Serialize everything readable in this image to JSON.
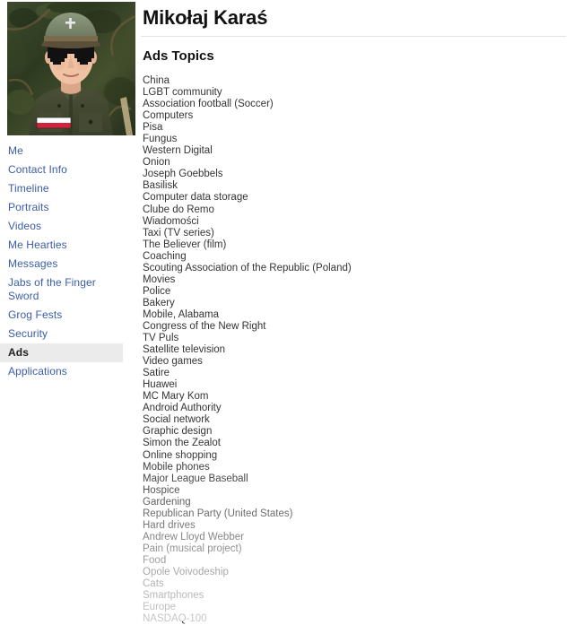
{
  "profile": {
    "name": "Mikołaj Karaś",
    "photo_alt": "profile-portrait-person-in-uniform-with-cap-and-sunglasses"
  },
  "sidebar": {
    "items": [
      {
        "label": "Me",
        "active": false
      },
      {
        "label": "Contact Info",
        "active": false
      },
      {
        "label": "Timeline",
        "active": false
      },
      {
        "label": "Portraits",
        "active": false
      },
      {
        "label": "Videos",
        "active": false
      },
      {
        "label": "Me Hearties",
        "active": false
      },
      {
        "label": "Messages",
        "active": false
      },
      {
        "label": "Jabs of the Finger Sword",
        "active": false
      },
      {
        "label": "Grog Fests",
        "active": false
      },
      {
        "label": "Security",
        "active": false
      },
      {
        "label": "Ads",
        "active": true
      },
      {
        "label": "Applications",
        "active": false
      }
    ]
  },
  "main": {
    "section_title": "Ads Topics",
    "topics": [
      "China",
      "LGBT community",
      "Association football (Soccer)",
      "Computers",
      "Pisa",
      "Fungus",
      "Western Digital",
      "Onion",
      "Joseph Goebbels",
      "Basilisk",
      "Computer data storage",
      "Clube do Remo",
      "Wiadomości",
      "Taxi (TV series)",
      "The Believer (film)",
      "Coaching",
      "Scouting Association of the Republic (Poland)",
      "Movies",
      "Police",
      "Bakery",
      "Mobile, Alabama",
      "Congress of the New Right",
      "TV Puls",
      "Satellite television",
      "Video games",
      "Satire",
      "Huawei",
      "MC Mary Kom",
      "Android Authority",
      "Social network",
      "Graphic design",
      "Simon the Zealot",
      "Online shopping",
      "Mobile phones",
      "Major League Baseball",
      "Hospice",
      "Gardening",
      "Republican Party (United States)",
      "Hard drives",
      "Andrew Lloyd Webber",
      "Pain (musical project)",
      "Food",
      "Opole Voivodeship",
      "Cats",
      "Smartphones",
      "Europe",
      "NASDAQ-100"
    ]
  },
  "colors": {
    "link": "#3b5ca8",
    "active_background": "#ebebeb",
    "text": "#343434",
    "divider": "#e3e3e5"
  }
}
